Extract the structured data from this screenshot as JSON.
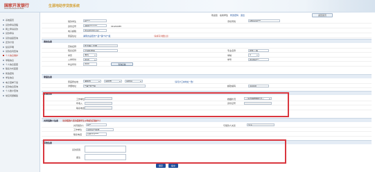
{
  "header": {
    "logo_cn": "国家开发银行",
    "logo_en": "China Development Bank",
    "system_title": "生源地助学贷款系统"
  },
  "user_bar": {
    "user_label": "欢迎您",
    "user_name": "在校学生",
    "logout": "退出",
    "change_password": "修改密码",
    "home_label": "返回首页"
  },
  "sidebar": {
    "items": [
      {
        "label": "系统首页"
      },
      {
        "label": "贷款申请流程"
      },
      {
        "label": "网上申请贷款"
      },
      {
        "label": "贷款申请"
      },
      {
        "label": "贷款进度查询"
      },
      {
        "label": "还款计划"
      },
      {
        "label": "续贷声明"
      },
      {
        "label": "贷款合同查询"
      },
      {
        "label": "个人信息维护"
      },
      {
        "label": "学籍信息"
      },
      {
        "label": "个人信息变更"
      },
      {
        "label": "联系方式变更"
      },
      {
        "label": "修改密码"
      },
      {
        "label": "学生信息"
      },
      {
        "label": "电子回单下载"
      },
      {
        "label": "还款信息查询"
      },
      {
        "label": "个人账户查询"
      },
      {
        "label": "常见问题解答"
      }
    ]
  },
  "personal": {
    "name_label": "借款学生",
    "name_value": "赵****",
    "phone_label": "手机号码",
    "phone_value": "1861234****",
    "id_label": "身份证号",
    "id_value": "4306**********",
    "qq_label": "QQ号码",
    "qq_value": "331234455",
    "email_label": "电子邮箱",
    "email_value": "zhao@163.com",
    "address_label": "家庭住址",
    "address_value": "湖南省岳阳市**县**镇**村**组",
    "note": "（请填写详细信息）"
  },
  "school_section": {
    "title": "高校信息",
    "school_name_label": "高校名称",
    "school_name_value": "长沙理工大学",
    "school_button": "查询高校",
    "college_label": "院系名称",
    "college_value": "计算机学院",
    "major_label": "专业名称",
    "major_value": "软件工程",
    "education_label": "学历",
    "education_value": "本科",
    "length_label": "学制",
    "length_value": "4",
    "enroll_label": "入学年份",
    "enroll_value": "2016",
    "student_no_label": "学号",
    "student_no_value": "201602***",
    "grad_label": "毕业年份",
    "grad_value": "2020"
  },
  "family_section": {
    "title": "家庭信息",
    "hometown_label": "家庭所在地",
    "province_value": "湖南省",
    "city_value": "岳阳市",
    "county_value": "岳阳县",
    "note": "（请与户口本地址一致）",
    "detail_label": "详细地址",
    "detail_value": "**镇**村**组",
    "zip_label": "邮政编码",
    "zip_value": "414100"
  },
  "spouse_section": {
    "title": "配偶信息",
    "work_unit_label": "工作单位",
    "work_unit_value": "",
    "income_label": "年收入",
    "income_value": "",
    "phone_label": "联系电话",
    "phone_value": "",
    "relation_label": "婚姻状况",
    "relation_value": "—请选择婚姻状况—",
    "id_label": "身份证号",
    "id_value": ""
  },
  "guardian_section": {
    "title": "共同借款人信息",
    "note": "（共同借款人须为借款学生父母或法定监护人）",
    "name_label": "共同借款人",
    "name_value": "赵**",
    "relation_label": "与借款人关系",
    "relation_value": "父子",
    "work_label": "工作单位",
    "work_value": "岳阳县**中学",
    "phone_label": "联系电话",
    "phone_value": "1387777****"
  },
  "remarks_section": {
    "title": "其他信息",
    "reason_label": "贷款原因",
    "remark_label": "备注"
  },
  "footer": {
    "save_label": "保存",
    "submit_label": "提交"
  },
  "colors": {
    "highlight": "#d9363e",
    "brand_red": "#c0392b",
    "link_blue": "#1d4f9b",
    "button_blue": "#1f4e9a"
  }
}
